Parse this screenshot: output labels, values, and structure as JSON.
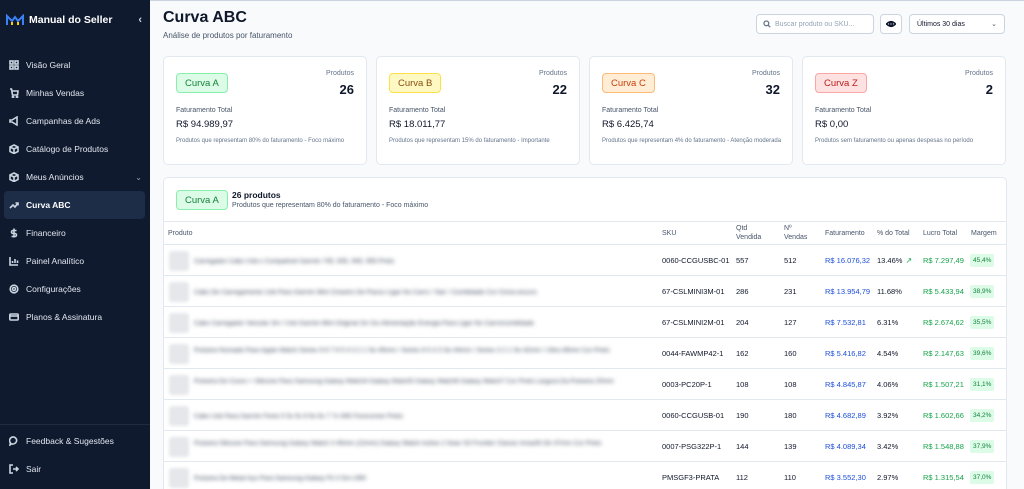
{
  "app": {
    "brand": "Manual do Seller"
  },
  "sidebar": {
    "items": [
      {
        "label": "Visão Geral",
        "icon": "dashboard-grid-icon"
      },
      {
        "label": "Minhas Vendas",
        "icon": "cart-icon"
      },
      {
        "label": "Campanhas de Ads",
        "icon": "megaphone-icon"
      },
      {
        "label": "Catálogo de Produtos",
        "icon": "package-icon"
      },
      {
        "label": "Meus Anúncios",
        "icon": "package-icon"
      },
      {
        "label": "Curva ABC",
        "icon": "trending-up-icon"
      },
      {
        "label": "Financeiro",
        "icon": "dollar-icon"
      },
      {
        "label": "Painel Analítico",
        "icon": "bar-chart-icon"
      },
      {
        "label": "Configurações",
        "icon": "gear-icon"
      },
      {
        "label": "Planos & Assinatura",
        "icon": "credit-card-icon"
      }
    ],
    "feedback": "Feedback & Sugestões",
    "logout": "Sair"
  },
  "header": {
    "title": "Curva ABC",
    "subtitle": "Análise de produtos por faturamento",
    "search_placeholder": "Buscar produto ou SKU...",
    "period": "Últimos 30 dias"
  },
  "cards": [
    {
      "badge": "Curva A",
      "products_label": "Produtos",
      "count": "26",
      "revenue_label": "Faturamento Total",
      "revenue": "R$ 94.989,97",
      "desc": "Produtos que representam 80% do faturamento - Foco máximo"
    },
    {
      "badge": "Curva B",
      "products_label": "Produtos",
      "count": "22",
      "revenue_label": "Faturamento Total",
      "revenue": "R$ 18.011,77",
      "desc": "Produtos que representam 15% do faturamento - Importante"
    },
    {
      "badge": "Curva C",
      "products_label": "Produtos",
      "count": "32",
      "revenue_label": "Faturamento Total",
      "revenue": "R$ 6.425,74",
      "desc": "Produtos que representam 4% do faturamento - Atenção moderada"
    },
    {
      "badge": "Curva Z",
      "products_label": "Produtos",
      "count": "2",
      "revenue_label": "Faturamento Total",
      "revenue": "R$ 0,00",
      "desc": "Produtos sem faturamento ou apenas despesas no período"
    }
  ],
  "section": {
    "badge": "Curva A",
    "title": "26 produtos",
    "desc": "Produtos que representam 80% do faturamento - Foco máximo"
  },
  "table": {
    "columns": {
      "produto": "Produto",
      "sku": "SKU",
      "qtd1": "Qtd",
      "qtd2": "Vendida",
      "nvendas1": "Nº",
      "nvendas2": "Vendas",
      "faturamento": "Faturamento",
      "pct": "% do Total",
      "lucro": "Lucro Total",
      "margem": "Margem"
    },
    "rows": [
      {
        "name": "Carregador Cabo Usb-c Compatível Garmin 745, 935, 945, 955 Preto",
        "sku": "0060-CCGUSBC-01",
        "qtd": "557",
        "vendas": "512",
        "fat": "R$ 16.076,32",
        "pct": "13.46%",
        "lucro": "R$ 7.297,49",
        "margem": "45,4%"
      },
      {
        "name": "Cabo De Carregamento Usb Para Garmin Mini Cinastro De Passo Ligar No Carro / Sair / Comitidade Cor Cinza-escuro",
        "sku": "67-CSLMINI3M-01",
        "qtd": "286",
        "vendas": "231",
        "fat": "R$ 13.954,79",
        "pct": "11.68%",
        "lucro": "R$ 5.433,94",
        "margem": "38,9%"
      },
      {
        "name": "Cabo Carregador Veicular 3m / Usb Garmin Mini Original 2m Ou Alimentação Energia Para Ligar No Carro/comitidade",
        "sku": "67-CSLMINI2M-01",
        "qtd": "204",
        "vendas": "127",
        "fat": "R$ 7.532,81",
        "pct": "6.31%",
        "lucro": "R$ 2.674,62",
        "margem": "35,5%"
      },
      {
        "name": "Pulseira Nomade Para Apple Watch Series 9 8 7 6 5 4 3 2 1 Se 45mm / Series 6 5 4 3 Se 44mm / Series 3 2 1 Se 42mm / Ultra 49mm Cor Preto",
        "sku": "0044-FAWMP42-1",
        "qtd": "162",
        "vendas": "160",
        "fat": "R$ 5.416,82",
        "pct": "4.54%",
        "lucro": "R$ 2.147,63",
        "margem": "39,6%"
      },
      {
        "name": "Pulseira De Couro + Silicone Para Samsung Galaxy Watch4 Galaxy Watch5 Galaxy Watch6 Galaxy Watch7 Cor Preto Largura Da Pulseira 20mm",
        "sku": "0003-PC20P-1",
        "qtd": "108",
        "vendas": "108",
        "fat": "R$ 4.845,87",
        "pct": "4.06%",
        "lucro": "R$ 1.507,21",
        "margem": "31,1%"
      },
      {
        "name": "Cabo Usb Para Garmin Fenix 5 5x 5s 6 6x 6s 7 7x 945 Forerunner Preto",
        "sku": "0060-CCGUSB-01",
        "qtd": "190",
        "vendas": "180",
        "fat": "R$ 4.682,89",
        "pct": "3.92%",
        "lucro": "R$ 1.602,66",
        "margem": "34,2%"
      },
      {
        "name": "Pulseira Silicone Para Samsung Galaxy Watch 3 45mm (22mm) Galaxy Watch Active 2 Gear S3 Frontier Classic Amazfit Gtr 47mm Cor Preto",
        "sku": "0007-PSG322P-1",
        "qtd": "144",
        "vendas": "139",
        "fat": "R$ 4.089,34",
        "pct": "3.42%",
        "lucro": "R$ 1.548,88",
        "margem": "37,9%"
      },
      {
        "name": "Pulseira De Metal Aço Para Samsung Galaxy Fit 3 Sm-r390",
        "sku": "PMSGF3-PRATA",
        "qtd": "112",
        "vendas": "110",
        "fat": "R$ 3.552,30",
        "pct": "2.97%",
        "lucro": "R$ 1.315,54",
        "margem": "37,0%"
      }
    ]
  },
  "colors": {
    "sidebar_bg": "#0f1a2e",
    "accent_blue": "#1d4ed8",
    "positive_green": "#16a34a",
    "curva_a": "#dcfce7",
    "curva_b": "#fef9c3",
    "curva_c": "#ffedd5",
    "curva_z": "#fee2e2"
  }
}
